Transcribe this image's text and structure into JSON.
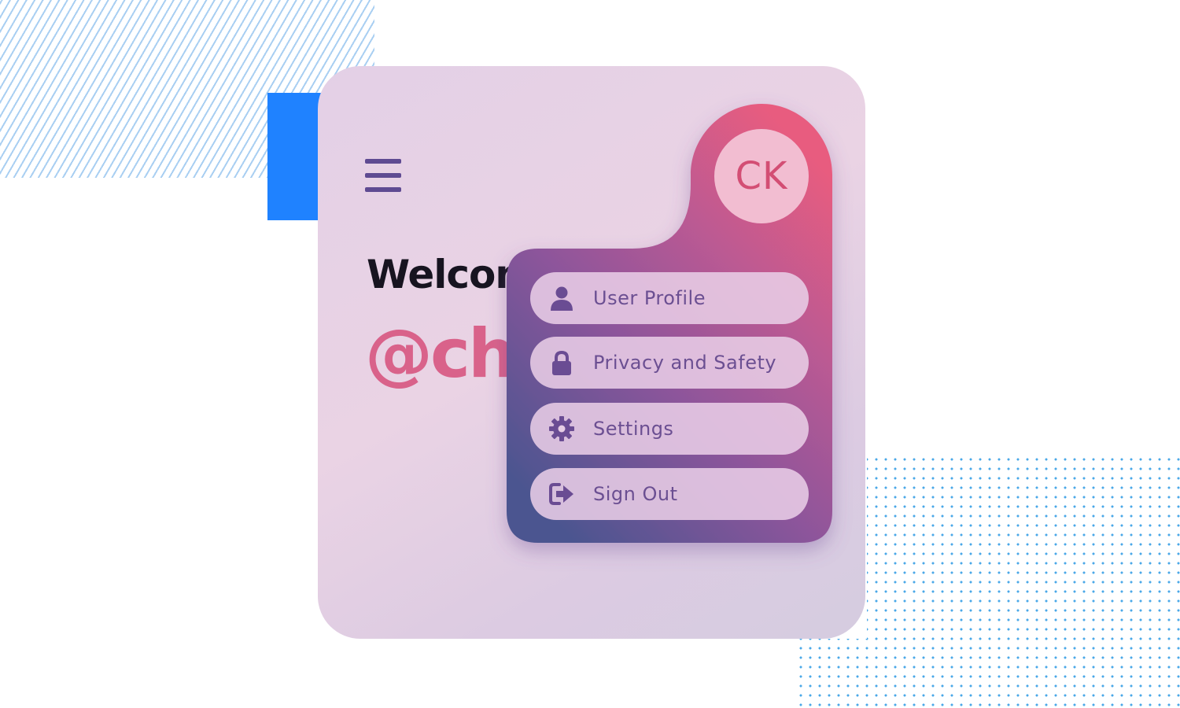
{
  "app": {
    "welcome_text": "Welcom",
    "handle_text": "@ch"
  },
  "profile": {
    "initials": "CK"
  },
  "menu": {
    "items": [
      {
        "label": "User Profile",
        "icon": "user-icon"
      },
      {
        "label": "Privacy and Safety",
        "icon": "lock-icon"
      },
      {
        "label": "Settings",
        "icon": "gear-icon"
      },
      {
        "label": "Sign Out",
        "icon": "sign-out-icon"
      }
    ]
  },
  "colors": {
    "card_background": "#e6d2e6",
    "menu_gradient_top": "#e45a82",
    "menu_gradient_bottom": "#4c5590",
    "icon_color": "#6a4c93",
    "accent_blue": "#1f82ff",
    "welcome_text": "#171420",
    "handle_text": "#d9628a",
    "avatar_text": "#d34e74"
  }
}
